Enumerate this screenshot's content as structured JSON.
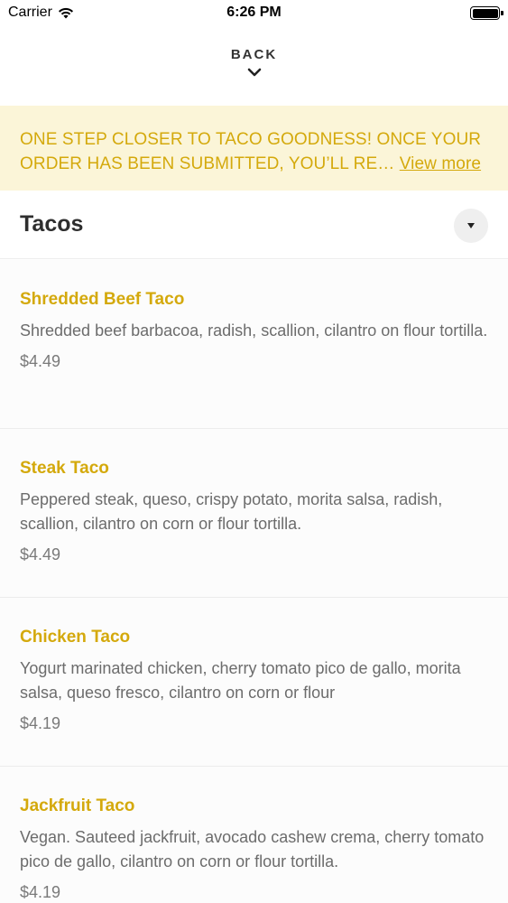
{
  "status_bar": {
    "carrier": "Carrier",
    "time": "6:26 PM",
    "battery_level": 1.0
  },
  "nav": {
    "back_label": "BACK"
  },
  "banner": {
    "text": "ONE STEP CLOSER TO TACO GOODNESS! ONCE YOUR ORDER HAS BEEN SUBMITTED, YOU’LL RE…",
    "link_label": "View more"
  },
  "section": {
    "title": "Tacos"
  },
  "items": [
    {
      "name": "Shredded Beef Taco",
      "description": "Shredded beef barbacoa, radish, scallion, cilantro on flour tortilla.",
      "price": "$4.49"
    },
    {
      "name": "Steak Taco",
      "description": "Peppered steak, queso, crispy potato, morita salsa, radish, scallion, cilantro on corn or flour tortilla.",
      "price": "$4.49"
    },
    {
      "name": "Chicken Taco",
      "description": "Yogurt marinated chicken, cherry tomato pico de gallo, morita salsa, queso fresco, cilantro on corn or flour",
      "price": "$4.19"
    },
    {
      "name": "Jackfruit Taco",
      "description": "Vegan. Sauteed jackfruit, avocado cashew crema, cherry tomato pico de gallo, cilantro on corn or flour tortilla.",
      "price": "$4.19"
    }
  ],
  "colors": {
    "accent": "#d4a90c",
    "banner_bg": "#fbf5d8",
    "text_primary": "#2e2e2e",
    "text_secondary": "#6c6c6c"
  }
}
